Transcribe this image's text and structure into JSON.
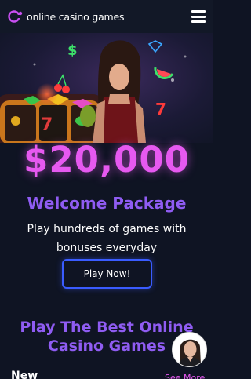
{
  "brand": {
    "logo_text": "online casino games",
    "logo_icon": "casino-chip-logo-icon"
  },
  "header": {
    "menu_icon": "hamburger-menu-icon"
  },
  "hero": {
    "image": "casino-woman-slot-machine-illustration",
    "amount": "$20,000",
    "title": "Welcome Package",
    "description": "Play hundreds of games with bonuses everyday",
    "cta_label": "Play Now!"
  },
  "games_section": {
    "title": "Play The Best Online Casino Games",
    "category_label": "New",
    "see_more_label": "See More"
  },
  "support": {
    "avatar_icon": "support-agent-avatar"
  },
  "colors": {
    "background": "#0f1423",
    "header": "#121827",
    "amount": "#e659f0",
    "accent_purple": "#8f5cf2",
    "button_border": "#3a5cff",
    "see_more": "#e659f0"
  }
}
